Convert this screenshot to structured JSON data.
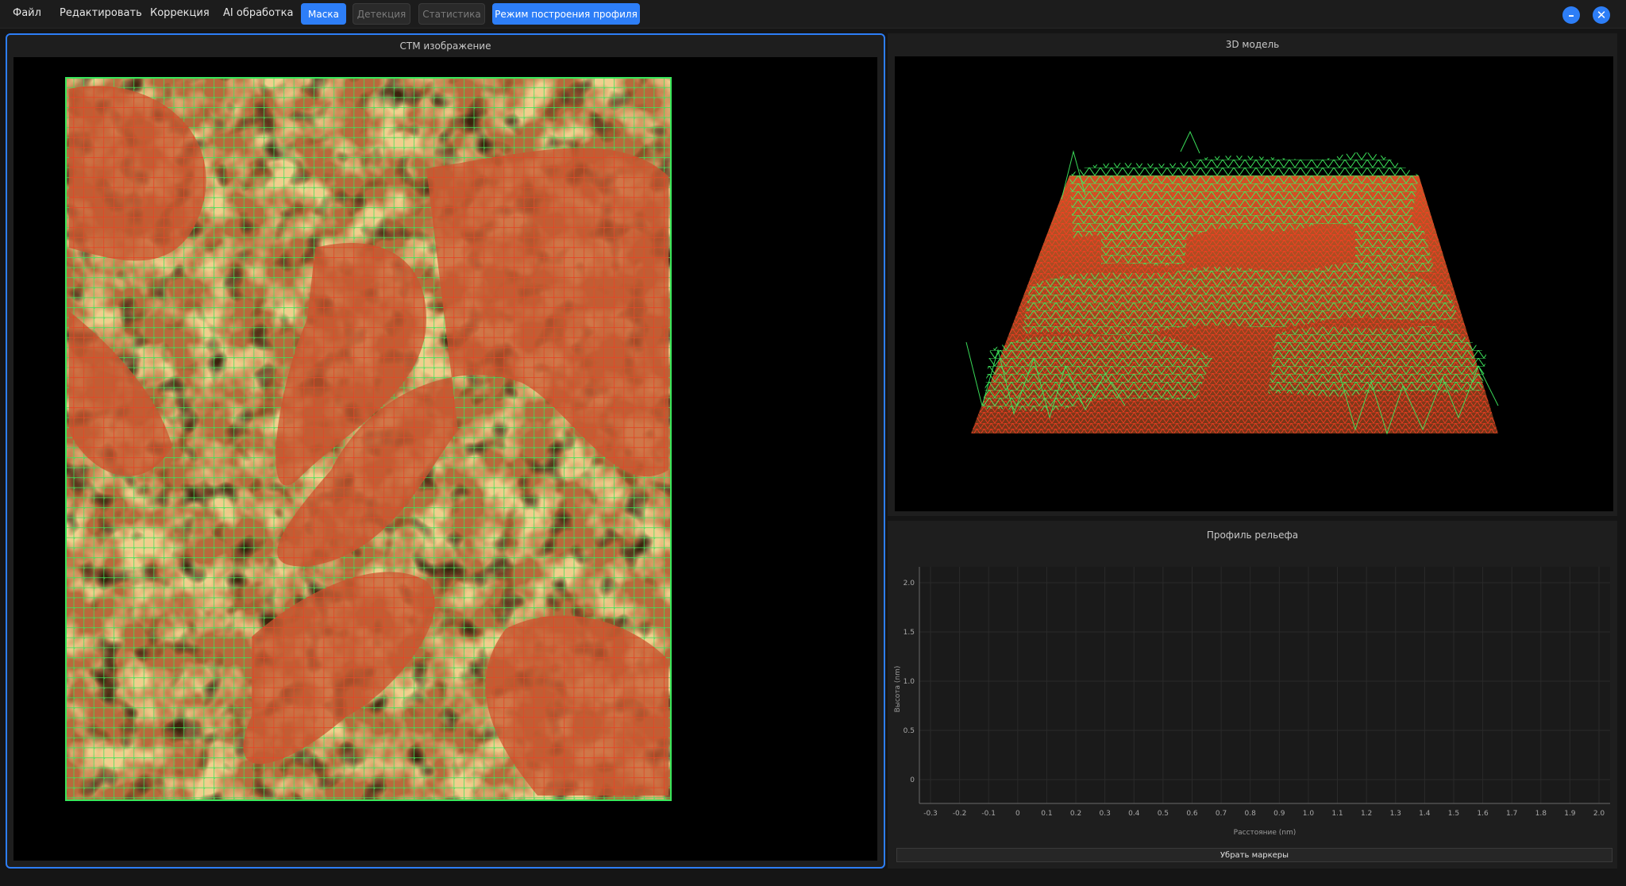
{
  "menu": {
    "items": [
      "Файл",
      "Редактировать",
      "Коррекция",
      "AI обработка"
    ]
  },
  "modes": {
    "mask": "Маска",
    "detection": "Детекция",
    "statistics": "Статистика",
    "profile_mode": "Режим построения профиля"
  },
  "window_controls": {
    "minimize_icon": "minimize-icon",
    "close_icon": "close-icon"
  },
  "stm_panel": {
    "title": "СТМ изображение"
  },
  "model_panel": {
    "title": "3D модель"
  },
  "profile_panel": {
    "title": "Профиль рельефа",
    "clear_markers": "Убрать маркеры"
  },
  "colors": {
    "accent": "#2d7ef7",
    "mesh_green": "#39e05a",
    "mesh_red": "#ff2a1a",
    "surface_light": "#e8c88a",
    "surface_dark": "#b5683a"
  },
  "chart_data": {
    "type": "line",
    "title": "Профиль рельефа",
    "xlabel": "Расстояние (nm)",
    "ylabel": "Высота (nm)",
    "xlim": [
      -0.3,
      2.0
    ],
    "ylim": [
      0,
      2.0
    ],
    "x_ticks": [
      "-0.3",
      "-0.2",
      "-0.1",
      "0",
      "0.1",
      "0.2",
      "0.3",
      "0.4",
      "0.5",
      "0.6",
      "0.7",
      "0.8",
      "0.9",
      "1.0",
      "1.1",
      "1.2",
      "1.3",
      "1.4",
      "1.5",
      "1.6",
      "1.7",
      "1.8",
      "1.9",
      "2.0"
    ],
    "y_ticks": [
      "0",
      "0.5",
      "1.0",
      "1.5",
      "2.0"
    ],
    "grid": true,
    "series": []
  }
}
